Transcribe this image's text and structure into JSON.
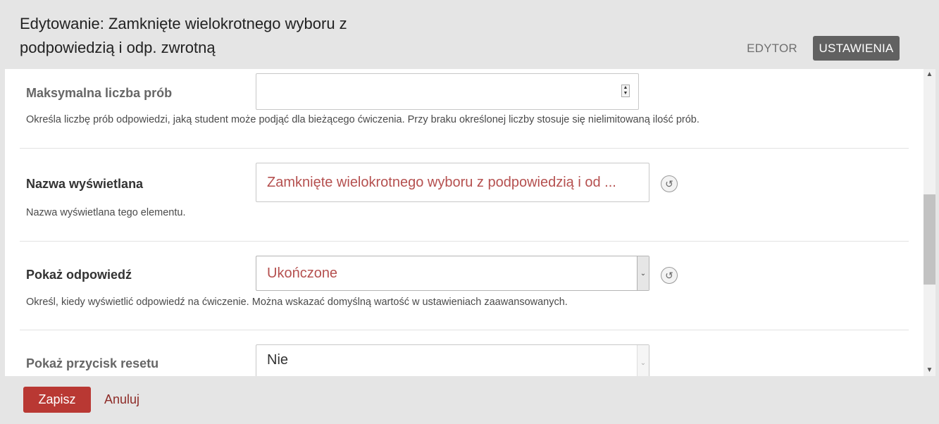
{
  "header": {
    "title_line1": "Edytowanie: Zamknięte wielokrotnego wyboru z",
    "title_line2": "podpowiedzią i odp. zwrotną",
    "tab_editor": "EDYTOR",
    "tab_settings": "USTAWIENIA"
  },
  "settings": {
    "max_attempts": {
      "label": "Maksymalna liczba prób",
      "value": "",
      "help": "Określa liczbę prób odpowiedzi, jaką student może podjąć dla bieżącego ćwiczenia. Przy braku określonej liczby stosuje się nielimitowaną ilość prób."
    },
    "display_name": {
      "label": "Nazwa wyświetlana",
      "value": "Zamknięte wielokrotnego wyboru z podpowiedzią i od ...",
      "help": "Nazwa wyświetlana tego elementu."
    },
    "show_answer": {
      "label": "Pokaż odpowiedź",
      "value": "Ukończone",
      "help": "Określ, kiedy wyświetlić odpowiedź na ćwiczenie. Można wskazać domyślną wartość w ustawieniach zaawansowanych."
    },
    "show_reset": {
      "label": "Pokaż przycisk resetu",
      "value": "Nie"
    }
  },
  "footer": {
    "save": "Zapisz",
    "cancel": "Anuluj"
  },
  "icons": {
    "reset": "reset-icon",
    "dropdown": "chevron-down-icon",
    "spinner": "spinner-icon"
  },
  "colors": {
    "accent": "#b93833",
    "value_text": "#b5504f",
    "active_tab": "#616161"
  }
}
